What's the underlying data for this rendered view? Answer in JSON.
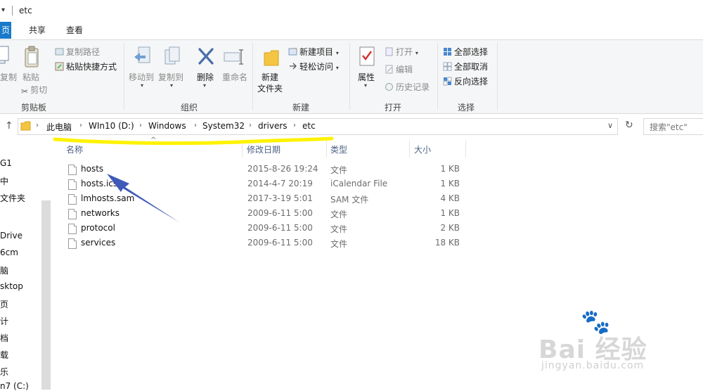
{
  "window": {
    "title": "etc",
    "quick_access_arrow": "▾"
  },
  "tabs": [
    {
      "label": "页"
    },
    {
      "label": "共享"
    },
    {
      "label": "查看"
    }
  ],
  "ribbon": {
    "clipboard": {
      "copy_label": "复制",
      "paste_label": "粘贴",
      "copy_path": "复制路径",
      "paste_shortcut": "粘贴快捷方式",
      "cut": "剪切",
      "group": "剪贴板"
    },
    "organize": {
      "move_to": "移动到",
      "copy_to": "复制到",
      "delete": "删除",
      "rename": "重命名",
      "group": "组织"
    },
    "new": {
      "new_item": "新建项目",
      "easy_access": "轻松访问",
      "new_folder": "新建\n文件夹",
      "new_folder_l1": "新建",
      "new_folder_l2": "文件夹",
      "group": "新建"
    },
    "open": {
      "properties": "属性",
      "open": "打开",
      "edit": "编辑",
      "history": "历史记录",
      "group": "打开"
    },
    "select": {
      "select_all": "全部选择",
      "select_none": "全部取消",
      "invert": "反向选择",
      "group": "选择"
    }
  },
  "address": {
    "up_arrow": "↑",
    "crumbs": [
      "此电脑",
      "WIn10 (D:)",
      "Windows",
      "System32",
      "drivers",
      "etc"
    ],
    "refresh": "↻",
    "dropdown": "∨",
    "search_placeholder": "搜索\"etc\""
  },
  "nav": {
    "items": [
      "G1",
      "中",
      "文件夹",
      "Drive",
      "6cm",
      "脑",
      "sktop",
      "页",
      "计",
      "档",
      "载",
      "乐",
      "n7 (C:)"
    ]
  },
  "columns": {
    "name": "名称",
    "modified": "修改日期",
    "type": "类型",
    "size": "大小",
    "sort_indicator": "^"
  },
  "files": [
    {
      "name": "hosts",
      "modified": "2015-8-26 19:24",
      "type": "文件",
      "size": "1 KB"
    },
    {
      "name": "hosts.ics",
      "modified": "2014-4-7 20:19",
      "type": "iCalendar File",
      "size": "1 KB"
    },
    {
      "name": "lmhosts.sam",
      "modified": "2017-3-19 5:01",
      "type": "SAM 文件",
      "size": "4 KB"
    },
    {
      "name": "networks",
      "modified": "2009-6-11 5:00",
      "type": "文件",
      "size": "1 KB"
    },
    {
      "name": "protocol",
      "modified": "2009-6-11 5:00",
      "type": "文件",
      "size": "2 KB"
    },
    {
      "name": "services",
      "modified": "2009-6-11 5:00",
      "type": "文件",
      "size": "18 KB"
    }
  ],
  "watermark": {
    "brand": "Bai 经验",
    "url": "jingyan.baidu.com"
  },
  "colors": {
    "home_tab": "#1979ca",
    "annotation_highlight": "#fff200",
    "annotation_arrow": "#3f5ab8"
  }
}
